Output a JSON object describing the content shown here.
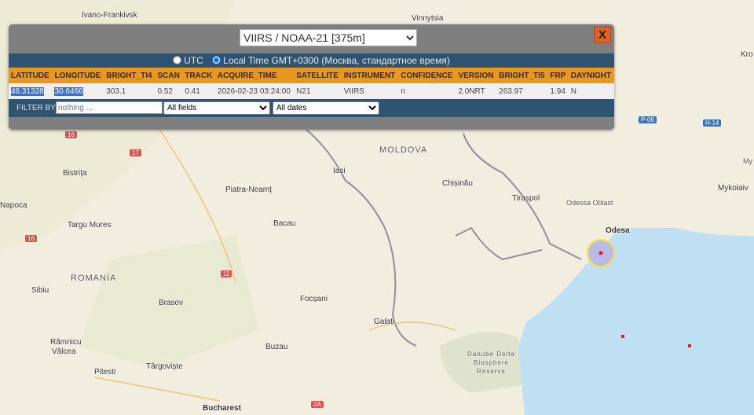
{
  "popup": {
    "product_select": "VIIRS / NOAA-21 [375m]",
    "close_label": "X",
    "timezone": {
      "utc_label": "UTC",
      "local_label": "Local Time GMT+0300 (Москва, стандартное время)",
      "selected": "local"
    },
    "columns": [
      "LATITUDE",
      "LONGITUDE",
      "BRIGHT_TI4",
      "SCAN",
      "TRACK",
      "ACQUIRE_TIME",
      "SATELLITE",
      "INSTRUMENT",
      "CONFIDENCE",
      "VERSION",
      "BRIGHT_TI5",
      "FRP",
      "DAYNIGHT"
    ],
    "row": [
      "46.31328",
      "30.6466",
      "303.1",
      "0.52",
      "0.41",
      "2026-02-23 03:24:00",
      "N21",
      "VIIRS",
      "n",
      "2.0NRT",
      "263.97",
      "1.94",
      "N"
    ],
    "filter": {
      "label": "FILTER BY",
      "placeholder": "nothing ...",
      "fields_select": "All fields",
      "dates_select": "All dates"
    }
  },
  "map": {
    "labels": {
      "ivano": "Ivano-Frankivsk",
      "vinnytsia": "Vinnytsia",
      "kro": "Kro",
      "myk": "My",
      "mykolaiv": "Mykolaiv",
      "moldova": "MOLDOVA",
      "iasi": "Iasi",
      "chisinau": "Chișinău",
      "tiraspol": "Tiraspol",
      "odessa_oblast": "Odessa Oblast",
      "odesa": "Odesa",
      "bistrita": "Bistrița",
      "piatra": "Piatra-Neamț",
      "napoca": "Napoca",
      "targu": "Targu Mures",
      "bacau": "Bacau",
      "romania": "ROMANIA",
      "sibiu": "Sibiu",
      "brasov": "Brasov",
      "focsani": "Focșani",
      "galati": "Galati",
      "ramnicu": "Râmnicu",
      "valcea": "Vâlcea",
      "buzau": "Buzau",
      "delta1": "Danube Delta",
      "delta2": "Biosphere",
      "delta3": "Reserve",
      "pitesti": "Pitesti",
      "targoviste": "Târgoviște",
      "bucharest": "Bucharest"
    },
    "shields": {
      "s1": "16",
      "s2": "17",
      "s3": "16",
      "s4": "11",
      "s5": "2A",
      "s6": "P-06",
      "s7": "H-14"
    },
    "colors": {
      "land": "#f1eedf",
      "sea": "#bfe0f2",
      "fire": "#e0201c",
      "highlight": "#f2e14a"
    }
  }
}
